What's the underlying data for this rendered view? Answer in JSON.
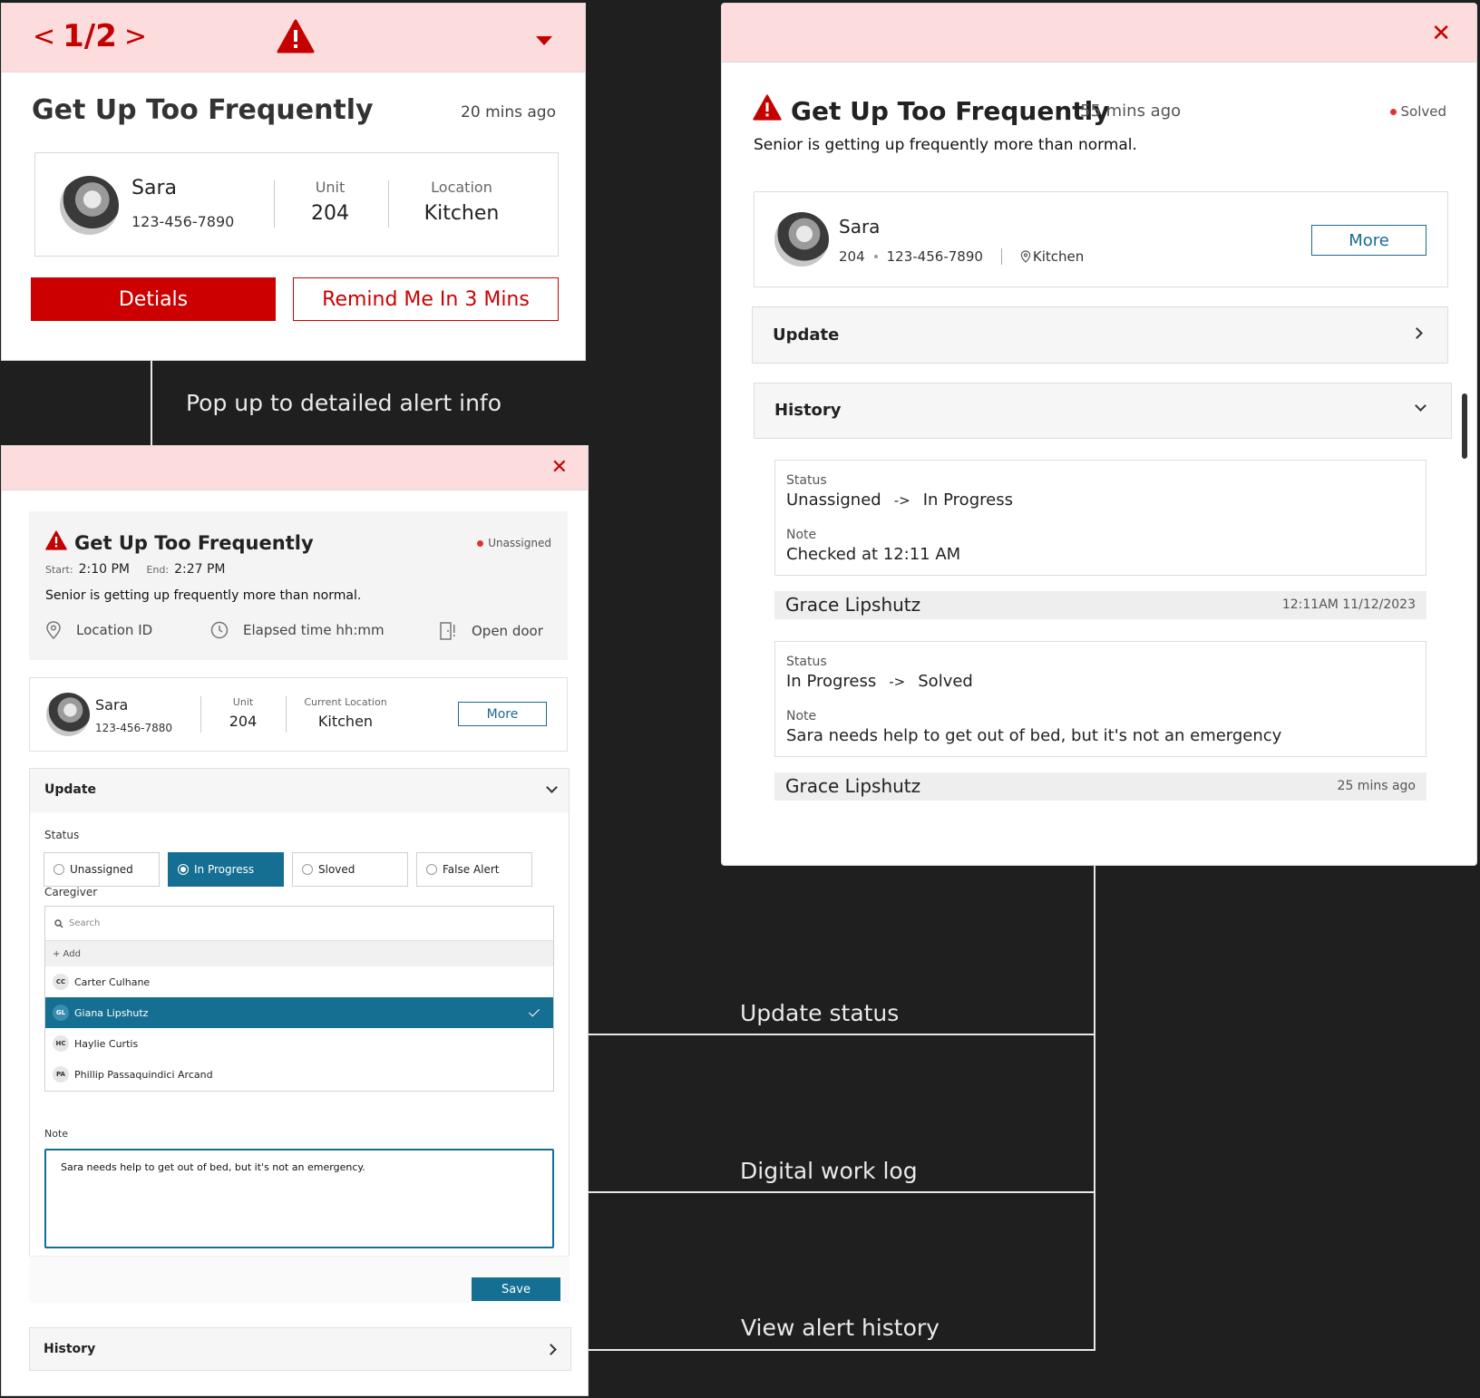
{
  "colors": {
    "alert_red": "#cc0000",
    "pink_header": "#fcdcdc",
    "teal": "#156f93",
    "background": "#1f1f1f"
  },
  "captions": {
    "popup": "Pop up to detailed alert info",
    "update_status": "Update status",
    "work_log": "Digital work log",
    "view_history": "View alert history"
  },
  "popup": {
    "pager_prev": "<",
    "pager": "1/2",
    "pager_next": ">",
    "title": "Get Up Too Frequently",
    "ago": "20 mins ago",
    "resident": {
      "name": "Sara",
      "phone": "123-456-7890"
    },
    "unit_label": "Unit",
    "unit": "204",
    "location_label": "Location",
    "location": "Kitchen",
    "details_button": "Detials",
    "remind_button": "Remind Me In 3 Mins"
  },
  "detail": {
    "close": "✕",
    "title": "Get Up Too Frequently",
    "status": "Unassigned",
    "start_label": "Start:",
    "start": "2:10 PM",
    "end_label": "End:",
    "end": "2:27 PM",
    "description": "Senior is getting up frequently more than normal.",
    "meta": {
      "location": "Location ID",
      "elapsed": "Elapsed time hh:mm",
      "door": "Open door"
    },
    "resident": {
      "name": "Sara",
      "phone": "123-456-7880"
    },
    "unit_label": "Unit",
    "unit": "204",
    "location_label": "Current Location",
    "location": "Kitchen",
    "more_button": "More",
    "update": {
      "title": "Update",
      "status_label": "Status",
      "statuses": [
        "Unassigned",
        "In Progress",
        "Sloved",
        "False Alert"
      ],
      "selected_status": "In Progress",
      "caregiver_label": "Caregiver",
      "search_placeholder": "Search",
      "add_label": "+ Add",
      "caregivers": [
        {
          "initials": "CC",
          "name": "Carter Culhane"
        },
        {
          "initials": "GL",
          "name": "Giana Lipshutz"
        },
        {
          "initials": "HC",
          "name": "Haylie Curtis"
        },
        {
          "initials": "PA",
          "name": "Phillip Passaquindici Arcand"
        }
      ],
      "selected_caregiver": "Giana Lipshutz",
      "note_label": "Note",
      "note": "Sara needs help to get out of bed, but it's not an emergency.",
      "save_button": "Save"
    },
    "history_title": "History"
  },
  "history_panel": {
    "close": "✕",
    "title": "Get Up Too Frequently",
    "ago": "55 mins ago",
    "status": "Solved",
    "description": "Senior is getting up frequently more than normal.",
    "resident": {
      "name": "Sara",
      "unit": "204",
      "phone": "123-456-7890",
      "location": "Kitchen"
    },
    "more_button": "More",
    "update_title": "Update",
    "history_title": "History",
    "entries": [
      {
        "status_label": "Status",
        "from": "Unassigned",
        "arrow": "->",
        "to": "In Progress",
        "note_label": "Note",
        "note": "Checked at 12:11 AM",
        "caregiver": "Grace Lipshutz",
        "time": "12:11AM 11/12/2023"
      },
      {
        "status_label": "Status",
        "from": "In Progress",
        "arrow": "->",
        "to": "Solved",
        "note_label": "Note",
        "note": "Sara needs help to get out of bed, but it's not an emergency",
        "caregiver": "Grace Lipshutz",
        "time": "25 mins ago"
      }
    ]
  }
}
